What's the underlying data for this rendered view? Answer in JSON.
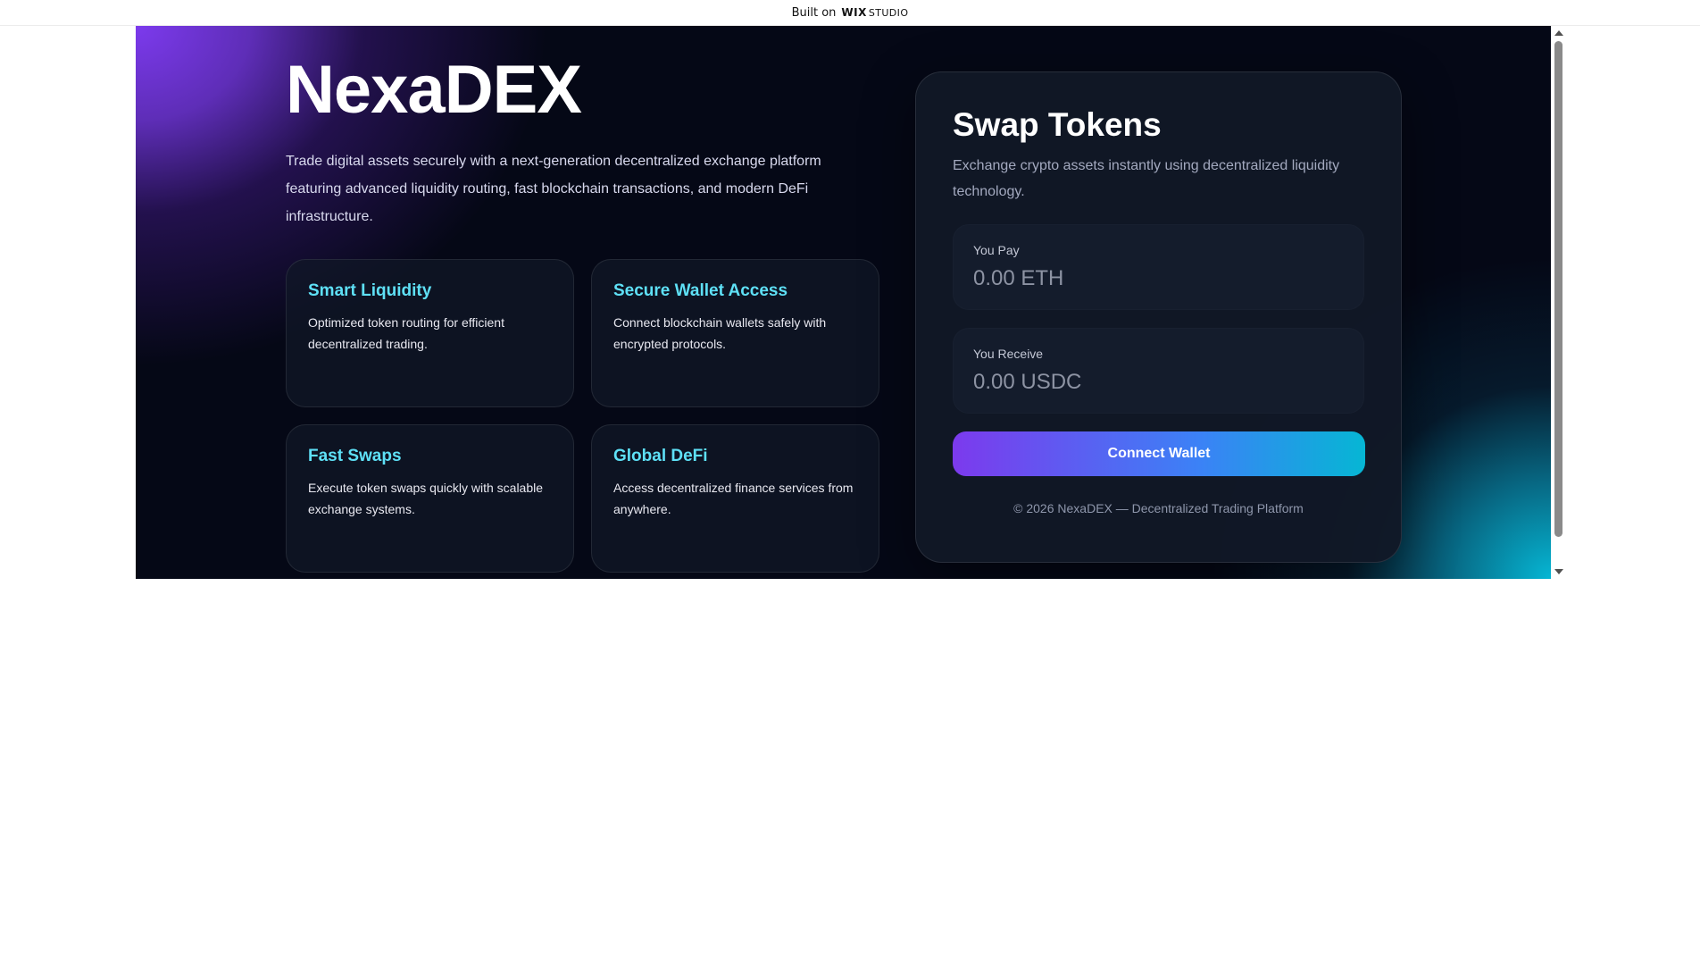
{
  "wix_banner": {
    "built_on": "Built on",
    "logo_wix": "WIX",
    "logo_studio": "STUDIO"
  },
  "hero": {
    "brand": "NexaDEX",
    "description": "Trade digital assets securely with a next-generation decentralized exchange platform featuring advanced liquidity routing, fast blockchain transactions, and modern DeFi infrastructure."
  },
  "features": [
    {
      "title": "Smart Liquidity",
      "description": "Optimized token routing for efficient decentralized trading."
    },
    {
      "title": "Secure Wallet Access",
      "description": "Connect blockchain wallets safely with encrypted protocols."
    },
    {
      "title": "Fast Swaps",
      "description": "Execute token swaps quickly with scalable exchange systems."
    },
    {
      "title": "Global DeFi",
      "description": "Access decentralized finance services from anywhere."
    }
  ],
  "swap": {
    "title": "Swap Tokens",
    "description": "Exchange crypto assets instantly using decentralized liquidity technology.",
    "pay_label": "You Pay",
    "pay_placeholder": "0.00 ETH",
    "receive_label": "You Receive",
    "receive_placeholder": "0.00 USDC",
    "connect_label": "Connect Wallet",
    "footer": "© 2026 NexaDEX — Decentralized Trading Platform"
  },
  "colors": {
    "accent_purple": "#7c3aed",
    "accent_cyan": "#06b6d4",
    "feature_title": "#5ee0f6",
    "background": "#050816"
  }
}
